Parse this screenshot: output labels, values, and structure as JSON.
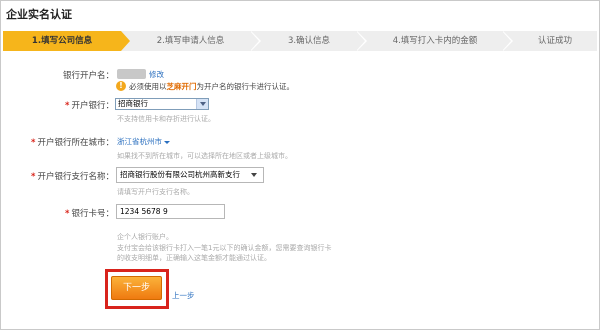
{
  "page": {
    "title": "企业实名认证"
  },
  "steps": [
    {
      "label": "1.填写公司信息",
      "active": true
    },
    {
      "label": "2.填写申请人信息",
      "active": false
    },
    {
      "label": "3.确认信息",
      "active": false
    },
    {
      "label": "4.填写打入卡内的金额",
      "active": false
    },
    {
      "label": "认证成功",
      "active": false
    }
  ],
  "form": {
    "account_name": {
      "label": "银行开户名：",
      "modify_link": "修改"
    },
    "warning": {
      "prefix": "必须使用以",
      "brand": "芝麻开门",
      "suffix": "为开户名的银行卡进行认证。"
    },
    "bank": {
      "label": "开户银行：",
      "value": "招商银行",
      "tip": "不支持信用卡和存折进行认证。"
    },
    "city": {
      "label": "开户银行所在城市：",
      "value": "浙江省杭州市",
      "tip": "如果找不到所在城市，可以选择所在地区或者上级城市。"
    },
    "branch": {
      "label": "开户银行支行名称：",
      "value": "招商银行股份有限公司杭州高新支行",
      "tip": "请填写开户行支行名称。"
    },
    "card": {
      "label": "银行卡号：",
      "value": "1234 5678 9",
      "tip1": "企个人银行账户。",
      "tip2": "支付宝会给该银行卡打入一笔1元以下的确认金额，您需要查询银行卡",
      "tip3": "的收支明细单，正确输入这笔金额才能通过认证。"
    }
  },
  "actions": {
    "next": "下一步",
    "prev": "上一步"
  },
  "colors": {
    "accent": "#f6b51b",
    "highlight": "#d8231c",
    "link": "#2a6fbf",
    "required": "#d9261c"
  }
}
